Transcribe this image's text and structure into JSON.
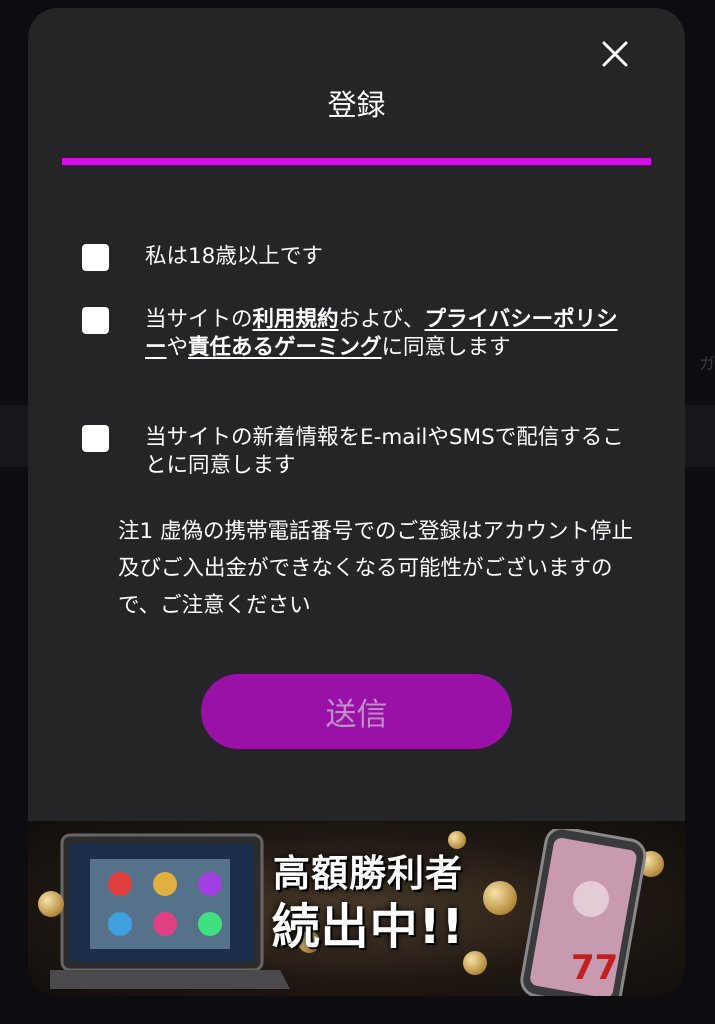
{
  "backdrop": {
    "side_text": "ガ"
  },
  "modal": {
    "title": "登録",
    "close_icon": "close-icon",
    "accent_color": "#d112e2",
    "checkboxes": [
      {
        "label": "私は18歳以上です",
        "checked": false
      },
      {
        "checked": false,
        "prefix": "当サイトの",
        "link_terms": "利用規約",
        "mid1": "および、",
        "link_privacy": "プライバシーポリシー",
        "mid2": "や",
        "link_gaming": "責任あるゲーミング",
        "suffix": "に同意します"
      },
      {
        "label": "当サイトの新着情報をE-mailやSMSで配信することに同意します",
        "checked": false
      }
    ],
    "note": "注1 虚偽の携帯電話番号でのご登録はアカウント停止及びご入出金ができなくなる可能性がございますので、ご注意ください",
    "submit_label": "送信",
    "submit_color": "#9a11a8"
  },
  "banner": {
    "line1": "高額勝利者",
    "line2": "続出中!!"
  }
}
